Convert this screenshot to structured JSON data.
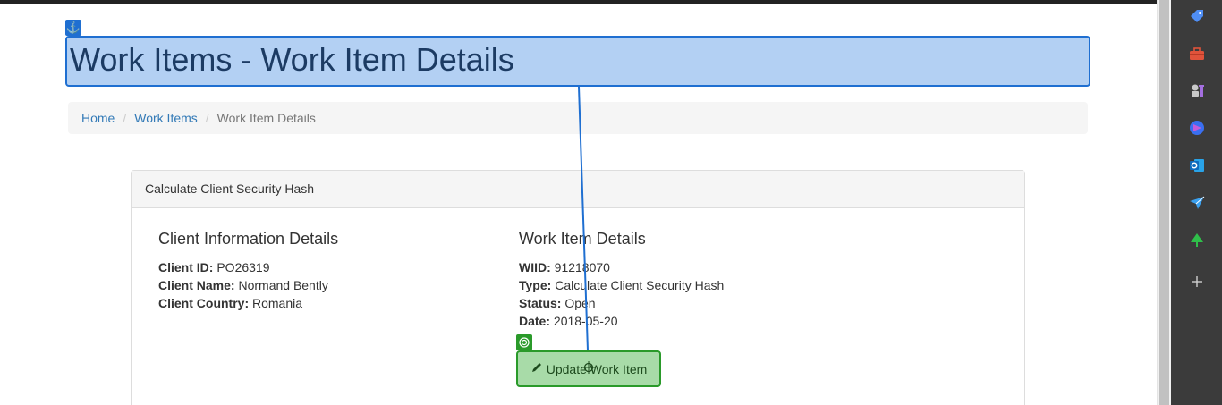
{
  "page": {
    "title": "Work Items - Work Item Details"
  },
  "breadcrumb": {
    "items": [
      {
        "label": "Home"
      },
      {
        "label": "Work Items"
      }
    ],
    "active": "Work Item Details",
    "separator": "/"
  },
  "panel": {
    "heading": "Calculate Client Security Hash",
    "client": {
      "title": "Client Information Details",
      "fields": [
        {
          "label": "Client ID:",
          "value": "PO26319"
        },
        {
          "label": "Client Name:",
          "value": "Normand Bently"
        },
        {
          "label": "Client Country:",
          "value": "Romania"
        }
      ]
    },
    "work_item": {
      "title": "Work Item Details",
      "fields": [
        {
          "label": "WIID:",
          "value": "91218070"
        },
        {
          "label": "Type:",
          "value": "Calculate Client Security Hash"
        },
        {
          "label": "Status:",
          "value": "Open"
        },
        {
          "label": "Date:",
          "value": "2018-05-20"
        }
      ]
    },
    "update_button": "Update Work Item"
  },
  "icons": {
    "anchor": "anchor-icon",
    "target": "target-icon",
    "pencil": "pencil-icon"
  },
  "sidebar": {
    "items": [
      "tag-icon",
      "toolbox-icon",
      "chess-icon",
      "copilot-icon",
      "outlook-icon",
      "send-icon",
      "tree-icon",
      "add-icon"
    ]
  },
  "colors": {
    "title_highlight": "#a0c4f0",
    "highlight_border": "#1f6fd1",
    "button_highlight": "#a8dba8",
    "button_border": "#2a9a2a",
    "link": "#337ab7"
  }
}
